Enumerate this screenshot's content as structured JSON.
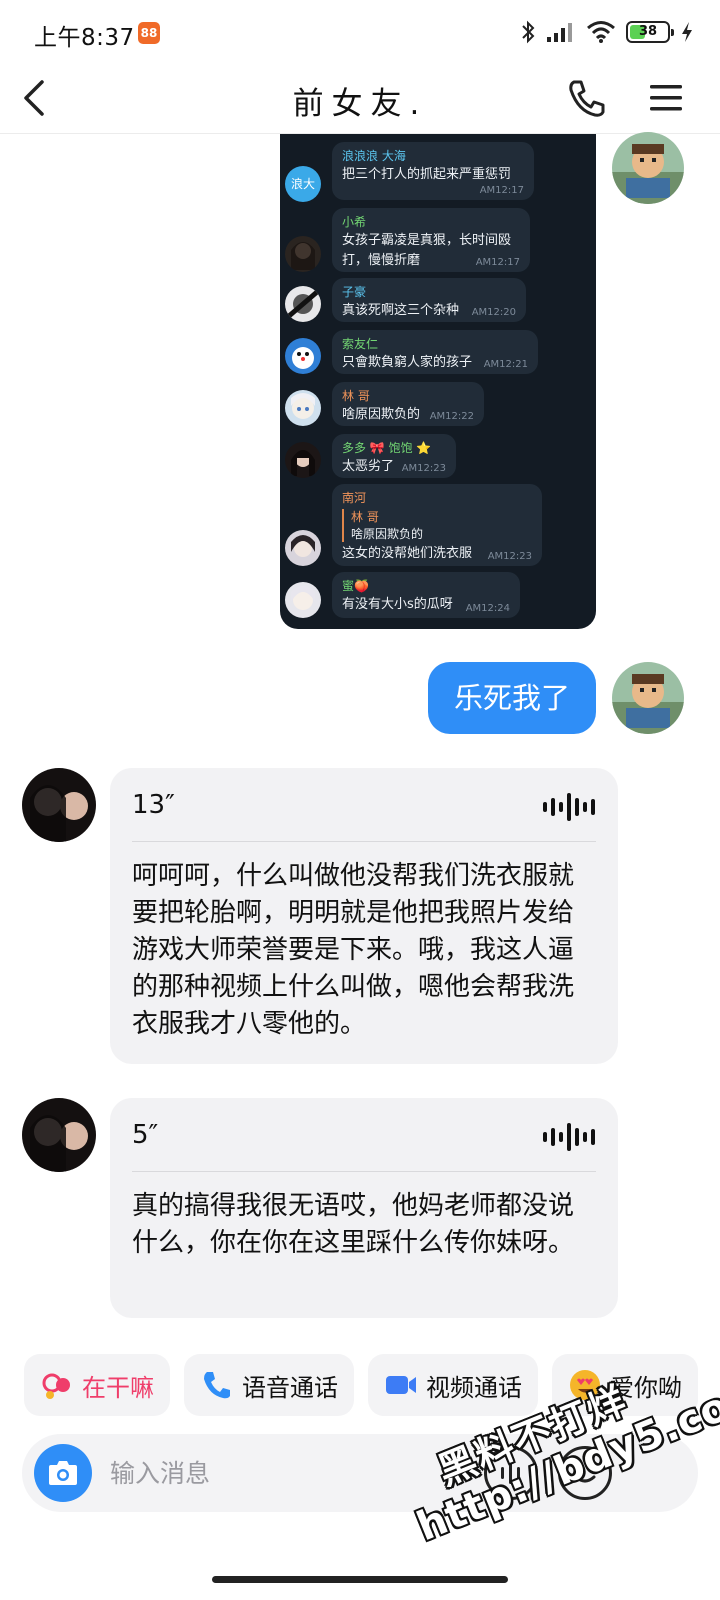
{
  "status_bar": {
    "time": "上午8:37",
    "battery": "38"
  },
  "header": {
    "title": "前女友."
  },
  "screenshot_messages": [
    {
      "name": "浪浪浪 大海",
      "name_color": "#5cc6f0",
      "text": "把三个打人的抓起来严重惩罚",
      "time": "AM12:17",
      "avatar_text": "浪大"
    },
    {
      "name": "小希",
      "name_color": "#73d673",
      "text": "女孩子霸凌是真狠，长时间殴\n打，慢慢折磨",
      "time": "AM12:17"
    },
    {
      "name": "子豪",
      "name_color": "#5cc6f0",
      "text": "真该死啊这三个杂种",
      "time": "AM12:20"
    },
    {
      "name": "索友仁",
      "name_color": "#73d673",
      "text": "只會欺負窮人家的孩子",
      "time": "AM12:21"
    },
    {
      "name": "林 哥",
      "name_color": "#f2955a",
      "text": "啥原因欺负的",
      "time": "AM12:22"
    },
    {
      "name": "多多 🎀 饱饱 ⭐",
      "name_color": "#73d673",
      "text": "太恶劣了",
      "time": "AM12:23"
    },
    {
      "name": "南河",
      "name_color": "#f2955a",
      "quote_name": "林 哥",
      "quote_text": "啥原因欺负的",
      "text": "这女的没帮她们洗衣服",
      "time": "AM12:23"
    },
    {
      "name": "蜜🍑",
      "name_color": "#73d673",
      "text": "有没有大小s的瓜呀",
      "time": "AM12:24"
    }
  ],
  "my_message": "乐死我了",
  "voice_messages": [
    {
      "duration": "13″",
      "transcript": "呵呵呵，什么叫做他没帮我们洗衣服就要把轮胎啊，明明就是他把我照片发给游戏大师荣誉要是下来。哦，我这人逼的那种视频上什么叫做，嗯他会帮我洗衣服我才八零他的。"
    },
    {
      "duration": "5″",
      "transcript": "真的搞得我很无语哎，他妈老师都没说什么，你在你在这里踩什么传你妹呀。"
    }
  ],
  "quick_actions": [
    {
      "label": "在干嘛",
      "icon": "heart-chat-icon",
      "color": "#ef3d6a"
    },
    {
      "label": "语音通话",
      "icon": "phone-icon",
      "color": "#2f8ef7"
    },
    {
      "label": "视频通话",
      "icon": "video-icon",
      "color": "#3d7cf5"
    },
    {
      "label": "爱你呦",
      "icon": "heart-eyes-emoji-icon",
      "color": "#f5b52a"
    }
  ],
  "input": {
    "placeholder": "输入消息"
  },
  "watermark": {
    "line1": "黑料不打烊",
    "line2": "http://bdy5.co"
  }
}
